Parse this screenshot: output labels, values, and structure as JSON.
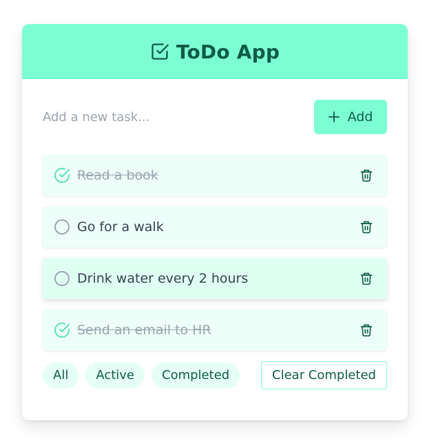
{
  "app": {
    "title": "ToDo App",
    "logo_icon": "checkbox-icon"
  },
  "add": {
    "placeholder": "Add a new task...",
    "value": "",
    "button_label": "Add",
    "button_icon": "plus-icon"
  },
  "tasks": [
    {
      "text": "Read a book",
      "completed": true
    },
    {
      "text": "Go for a walk",
      "completed": false
    },
    {
      "text": "Drink water every 2 hours",
      "completed": false
    },
    {
      "text": "Send an email to HR",
      "completed": true
    }
  ],
  "filters": [
    {
      "label": "All"
    },
    {
      "label": "Active"
    },
    {
      "label": "Completed"
    }
  ],
  "clear_label": "Clear Completed",
  "colors": {
    "accent": "#7dffd4",
    "accent_dark": "#0f5c45",
    "task_bg": "#edfff8",
    "complete_check": "#5ee3b4",
    "incomplete_check": "#9ca3af"
  }
}
